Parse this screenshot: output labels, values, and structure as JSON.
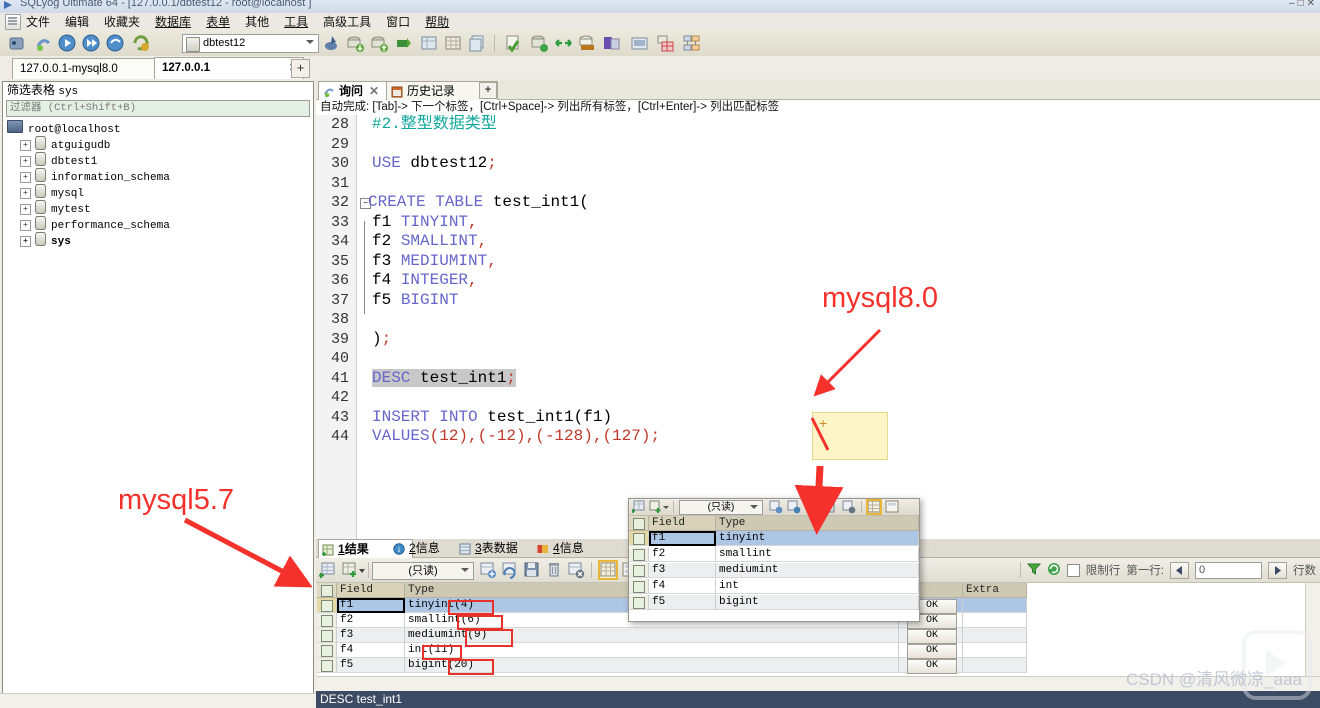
{
  "window": {
    "title": "SQLyog Ultimate 64 - [127.0.0.1/dbtest12 - root@localhost ]",
    "min": "–",
    "max": "□",
    "close": "✕"
  },
  "menu": {
    "items": [
      "文件",
      "编辑",
      "收藏夹",
      "数据库",
      "表单",
      "其他",
      "工具",
      "高级工具",
      "窗口",
      "帮助"
    ]
  },
  "toolbar": {
    "database_value": "dbtest12"
  },
  "connection_tabs": {
    "tabs": [
      {
        "label": "127.0.0.1-mysql8.0",
        "active": false,
        "closable": false
      },
      {
        "label": "127.0.0.1",
        "active": true,
        "closable": true
      }
    ],
    "add_label": "+"
  },
  "sidebar": {
    "title_label": "筛选表格",
    "title_value": "sys",
    "filter_placeholder": "过滤器 (Ctrl+Shift+B)",
    "root": "root@localhost",
    "databases": [
      {
        "name": "atguigudb",
        "bold": false
      },
      {
        "name": "dbtest1",
        "bold": false
      },
      {
        "name": "information_schema",
        "bold": false
      },
      {
        "name": "mysql",
        "bold": false
      },
      {
        "name": "mytest",
        "bold": false
      },
      {
        "name": "performance_schema",
        "bold": false
      },
      {
        "name": "sys",
        "bold": true
      }
    ],
    "expander": "+"
  },
  "editor_tabs": {
    "tabs": [
      {
        "label": "询问",
        "active": true,
        "closable": true,
        "icon": "query-icon"
      },
      {
        "label": "历史记录",
        "active": false,
        "closable": false,
        "icon": "history-icon"
      }
    ],
    "add_label": "+"
  },
  "hint_bar": {
    "text": "自动完成: [Tab]-> 下一个标签，[Ctrl+Space]-> 列出所有标签，[Ctrl+Enter]-> 列出匹配标签"
  },
  "editor": {
    "lines": [
      {
        "n": 28,
        "tokens": [
          {
            "t": "#2.整型数据类型",
            "c": "cm"
          }
        ]
      },
      {
        "n": 29,
        "tokens": []
      },
      {
        "n": 30,
        "tokens": [
          {
            "t": "USE ",
            "c": "kw"
          },
          {
            "t": "dbtest12",
            "c": ""
          },
          {
            "t": ";",
            "c": "pn"
          }
        ]
      },
      {
        "n": 31,
        "tokens": []
      },
      {
        "n": 32,
        "tokens": [
          {
            "t": "CREATE TABLE ",
            "c": "kw"
          },
          {
            "t": "test_int1(",
            "c": ""
          }
        ],
        "fold": true
      },
      {
        "n": 33,
        "tokens": [
          {
            "t": "f1 ",
            "c": ""
          },
          {
            "t": "TINYINT",
            "c": "kw"
          },
          {
            "t": ",",
            "c": "pn"
          }
        ]
      },
      {
        "n": 34,
        "tokens": [
          {
            "t": "f2 ",
            "c": ""
          },
          {
            "t": "SMALLINT",
            "c": "kw"
          },
          {
            "t": ",",
            "c": "pn"
          }
        ]
      },
      {
        "n": 35,
        "tokens": [
          {
            "t": "f3 ",
            "c": ""
          },
          {
            "t": "MEDIUMINT",
            "c": "kw"
          },
          {
            "t": ",",
            "c": "pn"
          }
        ]
      },
      {
        "n": 36,
        "tokens": [
          {
            "t": "f4 ",
            "c": ""
          },
          {
            "t": "INTEGER",
            "c": "kw"
          },
          {
            "t": ",",
            "c": "pn"
          }
        ]
      },
      {
        "n": 37,
        "tokens": [
          {
            "t": "f5 ",
            "c": ""
          },
          {
            "t": "BIGINT",
            "c": "kw"
          }
        ]
      },
      {
        "n": 38,
        "tokens": []
      },
      {
        "n": 39,
        "tokens": [
          {
            "t": ")",
            "c": ""
          },
          {
            "t": ";",
            "c": "pn"
          }
        ]
      },
      {
        "n": 40,
        "tokens": []
      },
      {
        "n": 41,
        "tokens": [
          {
            "t": "DESC",
            "c": "kw sel"
          },
          {
            "t": " test_int1",
            "c": "sel"
          },
          {
            "t": ";",
            "c": "pn sel"
          }
        ]
      },
      {
        "n": 42,
        "tokens": []
      },
      {
        "n": 43,
        "tokens": [
          {
            "t": "INSERT INTO ",
            "c": "kw"
          },
          {
            "t": "test_int1(f1)",
            "c": ""
          }
        ]
      },
      {
        "n": 44,
        "tokens": [
          {
            "t": "VALUES",
            "c": "kw"
          },
          {
            "t": "(12),(-12),(-128),(127)",
            "c": "num"
          },
          {
            "t": ";",
            "c": "pn"
          }
        ]
      }
    ]
  },
  "result_tabs": {
    "tabs": [
      {
        "num": "1",
        "label": "结果",
        "active": true
      },
      {
        "num": "2",
        "label": "信息",
        "active": false
      },
      {
        "num": "3",
        "label": "表数据",
        "active": false
      },
      {
        "num": "4",
        "label": "信息",
        "active": false
      }
    ]
  },
  "result_toolbar": {
    "mode_value": "(只读)",
    "limit_rows_label": "限制行",
    "first_row_label": "第一行:",
    "first_row_value": "0",
    "row_count_label": "行数"
  },
  "result_grid": {
    "columns": [
      "Field",
      "Type",
      "",
      "Extra"
    ],
    "rows": [
      {
        "field": "f1",
        "type": "tinyint(4)",
        "ok": "OK",
        "extra": "",
        "selected": true
      },
      {
        "field": "f2",
        "type": "smallint(6)",
        "ok": "OK",
        "extra": "",
        "selected": false
      },
      {
        "field": "f3",
        "type": "mediumint(9)",
        "ok": "OK",
        "extra": "",
        "selected": false
      },
      {
        "field": "f4",
        "type": "int(11)",
        "ok": "OK",
        "extra": "",
        "selected": false
      },
      {
        "field": "f5",
        "type": "bigint(20)",
        "ok": "OK",
        "extra": "",
        "selected": false
      }
    ]
  },
  "popup_grid": {
    "mode_value": "(只读)",
    "columns": [
      "Field",
      "Type"
    ],
    "rows": [
      {
        "field": "f1",
        "type": "tinyint",
        "selected": true
      },
      {
        "field": "f2",
        "type": "smallint",
        "selected": false
      },
      {
        "field": "f3",
        "type": "mediumint",
        "selected": false
      },
      {
        "field": "f4",
        "type": "int",
        "selected": false
      },
      {
        "field": "f5",
        "type": "bigint",
        "selected": false
      }
    ]
  },
  "annotations": {
    "mysql80": "mysql8.0",
    "mysql57": "mysql5.7",
    "tooltip_plus": "+",
    "accent_red": "#f5312b"
  },
  "status_bar": {
    "text": "DESC test_int1"
  },
  "watermark": {
    "text": "CSDN @清风微凉_aaa"
  }
}
